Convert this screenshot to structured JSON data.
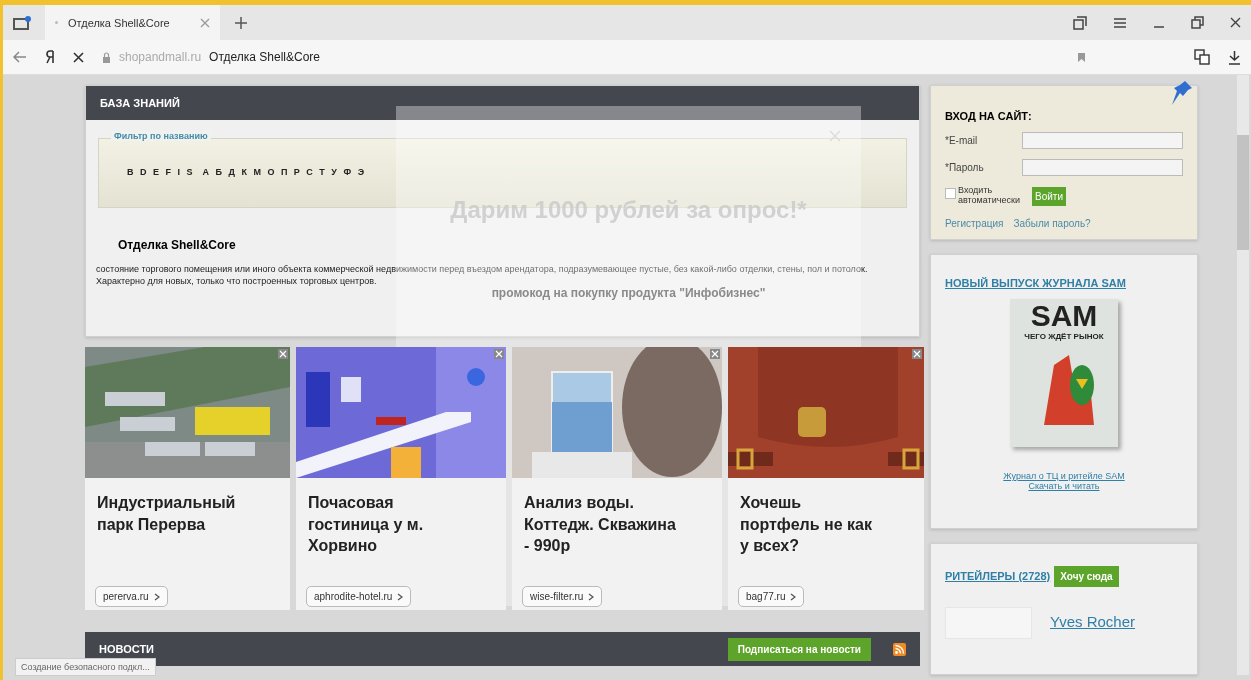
{
  "browser": {
    "tab_title": "Отделка Shell&Core",
    "url_domain": "shopandmall.ru",
    "url_title": "Отделка Shell&Core"
  },
  "knowledge": {
    "title": "БАЗА ЗНАНИЙ",
    "filter_label": "Фильтр по названию",
    "letters_latin": "B D E F I S",
    "letters_cyrillic": "А Б Д К М О П Р С Т У Ф Э",
    "article_title": "Отделка Shell&Core",
    "article_text": "состояние торгового помещения или иного объекта коммерческой недвижимости перед въездом арендатора, подразумевающее пустые, без какой-либо отделки, стены, пол и потолок. Характерно для новых, только что построенных торговых центров."
  },
  "popup": {
    "title": "Дарим 1000 рублей за опрос!*",
    "text": "промокод на покупку продукта \"Инфобизнес\""
  },
  "ads": [
    {
      "kind": "aerial",
      "title": "Индустриальный парк Перерва",
      "link": "pererva.ru"
    },
    {
      "kind": "hotel",
      "title": "Почасовая гостиница у м. Хорвино",
      "link": "aphrodite-hotel.ru"
    },
    {
      "kind": "lab",
      "title": "Анализ воды. Коттедж. Скважина - 990р",
      "link": "wise-filter.ru"
    },
    {
      "kind": "bag",
      "title": "Хочешь портфель не как у всех?",
      "link": "bag77.ru"
    }
  ],
  "news": {
    "title": "НОВОСТИ",
    "subscribe": "Подписаться на новости"
  },
  "login": {
    "title": "ВХОД НА САЙТ:",
    "email_label": "*E-mail",
    "password_label": "*Пароль",
    "remember_label": "Входить автоматически",
    "remember_checked": false,
    "submit": "Войти",
    "register": "Регистрация",
    "forgot": "Забыли пароль?"
  },
  "magazine": {
    "title": "НОВЫЙ ВЫПУСК ЖУРНАЛА SAM",
    "cover_logo": "SAM",
    "cover_headline": "ЧЕГО ЖДЁТ РЫНОК",
    "link_line1": "Журнал о ТЦ и ритейле SAM",
    "link_line2": "Скачать и читать"
  },
  "retailers": {
    "title": "РИТЕЙЛЕРЫ (2728)",
    "button": "Хочу сюда",
    "first": "Yves Rocher"
  },
  "status_bar": "Создание безопасного подкл..."
}
